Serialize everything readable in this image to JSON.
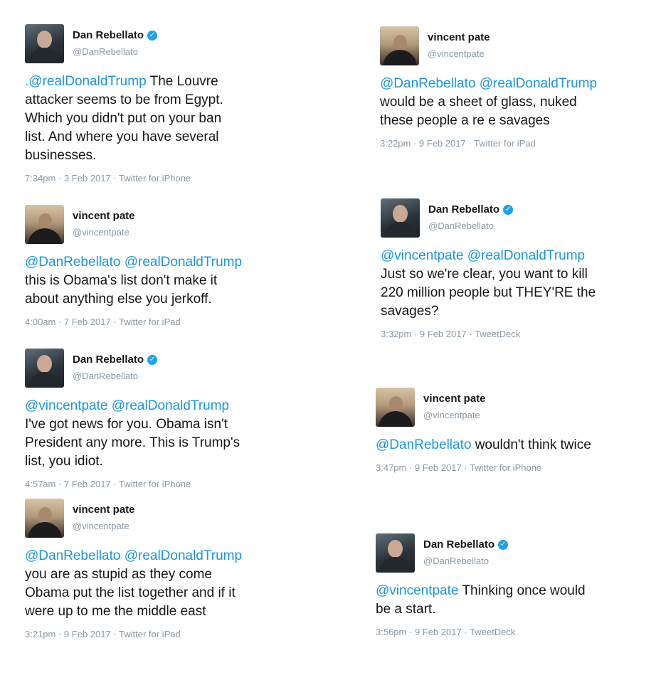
{
  "tweets": [
    {
      "author": "Dan Rebellato",
      "handle": "@DanRebellato",
      "verified": true,
      "mentions": ".@realDonaldTrump",
      "text": " The Louvre\nattacker seems to be from Egypt.\nWhich you didn't put on your ban\nlist. And where you have several\nbusinesses.",
      "timestamp": "7:34pm · 3 Feb 2017 · Twitter for iPhone"
    },
    {
      "author": "vincent pate",
      "handle": "@vincentpate",
      "verified": false,
      "mentions": "@DanRebellato @realDonaldTrump",
      "text": "\nthis is Obama's list don't make it\nabout anything else you jerkoff.",
      "timestamp": "4:00am · 7 Feb 2017 · Twitter for iPad"
    },
    {
      "author": "Dan Rebellato",
      "handle": "@DanRebellato",
      "verified": true,
      "mentions": "@vincentpate @realDonaldTrump",
      "text": "\nI've got news for you. Obama isn't\nPresident any more. This is Trump's\nlist, you idiot.",
      "timestamp": "4:57am · 7 Feb 2017 · Twitter for iPhone"
    },
    {
      "author": "vincent pate",
      "handle": "@vincentpate",
      "verified": false,
      "mentions": "@DanRebellato @realDonaldTrump",
      "text": "\nyou are as stupid as they come\nObama put the list together and if it\nwere up to me the middle east",
      "timestamp": "3:21pm · 9 Feb 2017 · Twitter for iPad"
    },
    {
      "author": "vincent pate",
      "handle": "@vincentpate",
      "verified": false,
      "mentions": "@DanRebellato @realDonaldTrump",
      "text": "\nwould be a sheet of glass, nuked\nthese people a re e savages",
      "timestamp": "3:22pm · 9 Feb 2017 · Twitter for iPad"
    },
    {
      "author": "Dan Rebellato",
      "handle": "@DanRebellato",
      "verified": true,
      "mentions": "@vincentpate @realDonaldTrump",
      "text": "\nJust so we're clear, you want to kill\n220 million people but THEY'RE the\nsavages?",
      "timestamp": "3:32pm · 9 Feb 2017 · TweetDeck"
    },
    {
      "author": "vincent pate",
      "handle": "@vincentpate",
      "verified": false,
      "mentions": "@DanRebellato",
      "text": " wouldn't think twice",
      "timestamp": "3:47pm · 9 Feb 2017 · Twitter for iPhone"
    },
    {
      "author": "Dan Rebellato",
      "handle": "@DanRebellato",
      "verified": true,
      "mentions": "@vincentpate",
      "text": " Thinking once would\nbe a start.",
      "timestamp": "3:56pm · 9 Feb 2017 · TweetDeck"
    }
  ],
  "icons": {
    "verified": "verified-badge-icon",
    "check_glyph": "✓",
    "verified_color": "#1da1f2"
  },
  "colors": {
    "link": "#1b95e0",
    "muted": "#8899a6",
    "text": "#14171a"
  }
}
